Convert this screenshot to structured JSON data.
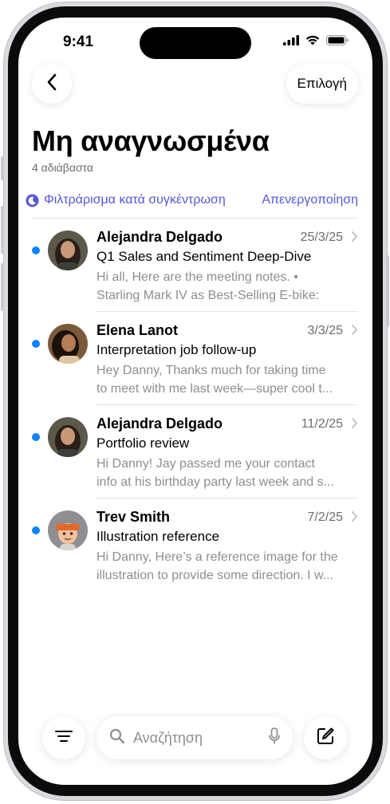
{
  "status": {
    "time": "9:41"
  },
  "nav": {
    "back_icon": "chevron-left-icon",
    "select_label": "Επιλογή"
  },
  "mailbox": {
    "title": "Μη αναγνωσμένα",
    "count_text": "4 αδιάβαστα",
    "focus_filter_label": "Φιλτράρισμα κατά συγκέντρωση",
    "focus_filter_action": "Απενεργοποίηση"
  },
  "messages": [
    {
      "sender": "Alejandra Delgado",
      "date": "25/3/25",
      "subject": "Q1 Sales and Sentiment Deep-Dive",
      "preview_line1": "Hi all, Here are the meeting notes. •",
      "preview_line2": "Starling Mark IV as Best-Selling E-bike:",
      "unread": true
    },
    {
      "sender": "Elena Lanot",
      "date": "3/3/25",
      "subject": "Interpretation job follow-up",
      "preview_line1": "Hey Danny, Thanks much for taking time",
      "preview_line2": "to meet with me last week—super cool t...",
      "unread": true
    },
    {
      "sender": "Alejandra Delgado",
      "date": "11/2/25",
      "subject": "Portfolio review",
      "preview_line1": "Hi Danny! Jay passed me your contact",
      "preview_line2": "info at his birthday party last week and s...",
      "unread": true
    },
    {
      "sender": "Trev Smith",
      "date": "7/2/25",
      "subject": "Illustration reference",
      "preview_line1": "Hi Danny, Here’s a reference image for the",
      "preview_line2": "illustration to provide some direction. I w...",
      "unread": true
    }
  ],
  "toolbar": {
    "filter_icon": "filter-lines-icon",
    "search_placeholder": "Αναζήτηση",
    "mic_icon": "microphone-icon",
    "compose_icon": "compose-icon"
  },
  "colors": {
    "unread_dot": "#0a84ff",
    "focus_accent": "#5856d6",
    "secondary_text": "#8e8e93"
  }
}
